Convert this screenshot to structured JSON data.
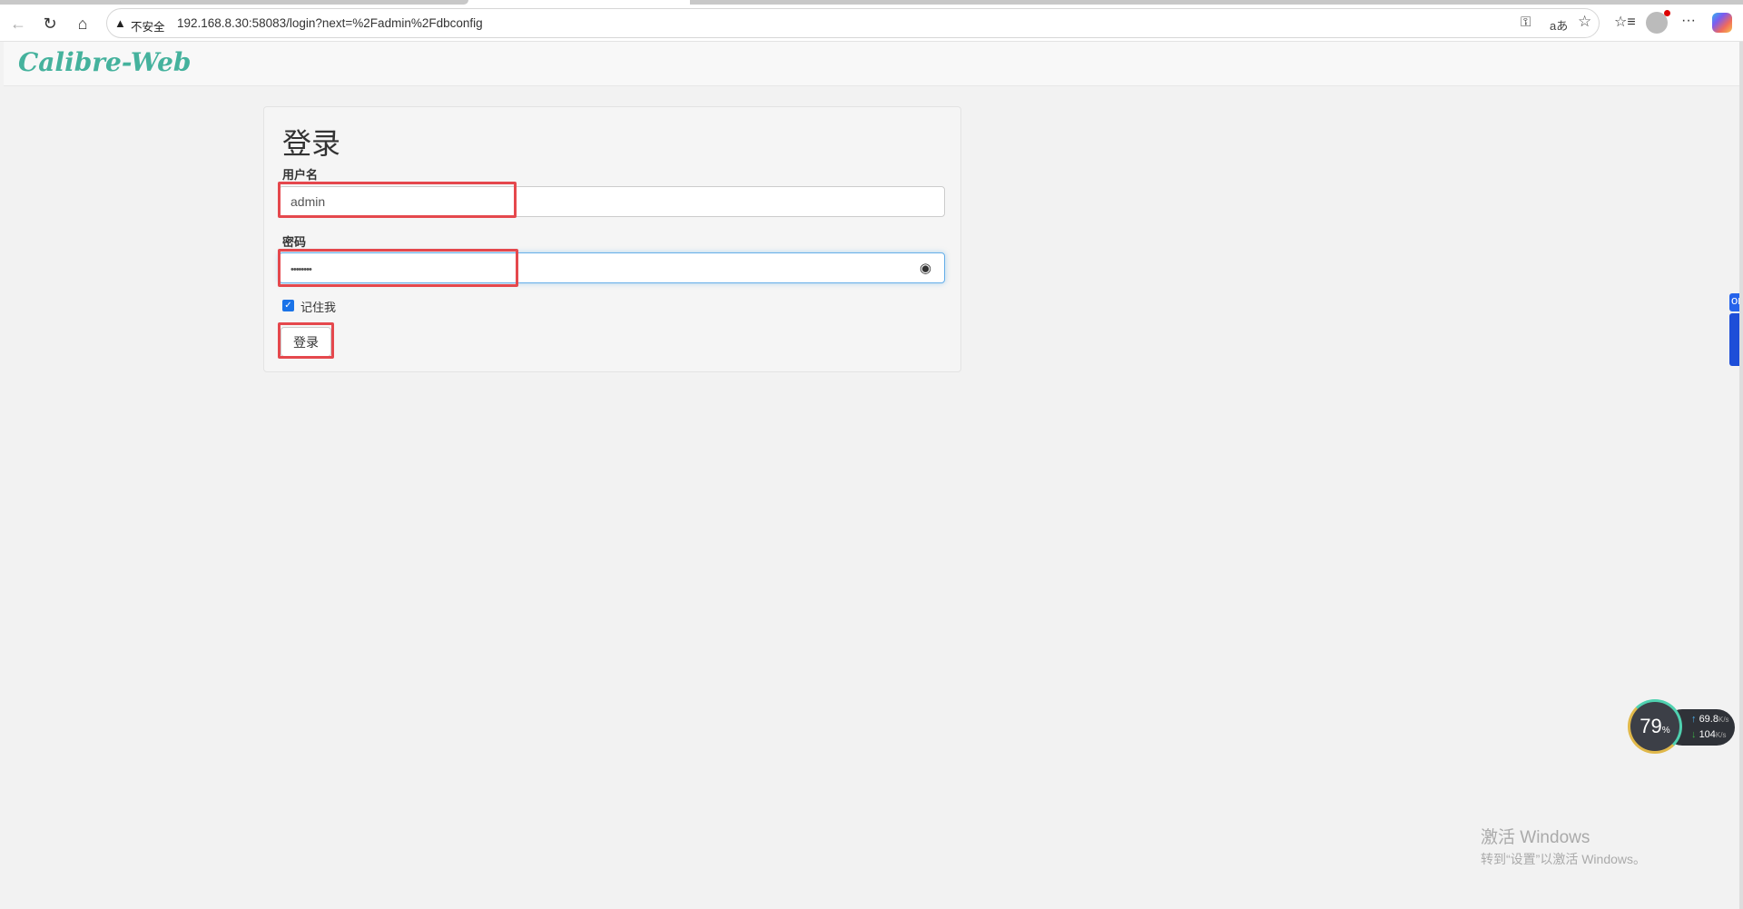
{
  "browser": {
    "security_icon": "warning-triangle-icon",
    "security_label": "不安全",
    "url": "192.168.8.30:58083/login?next=%2Fadmin%2Fdbconfig",
    "more_label": "···"
  },
  "navbar": {
    "brand": "Calibre-Web"
  },
  "login": {
    "title": "登录",
    "username_label": "用户名",
    "username_value": "admin",
    "password_label": "密码",
    "password_value": "••••••••",
    "remember_label": "记住我",
    "remember_checked": true,
    "submit_label": "登录"
  },
  "side_widget": {
    "label": "or"
  },
  "net_monitor": {
    "percent": "79",
    "percent_unit": "%",
    "up": "69.8",
    "up_unit": "K/s",
    "down": "104",
    "down_unit": "K/s"
  },
  "watermark": {
    "title": "激活 Windows",
    "subtitle": "转到“设置”以激活 Windows。"
  },
  "colors": {
    "brand": "#45b29d",
    "highlight": "#e5484d",
    "focus": "#66afe9"
  }
}
